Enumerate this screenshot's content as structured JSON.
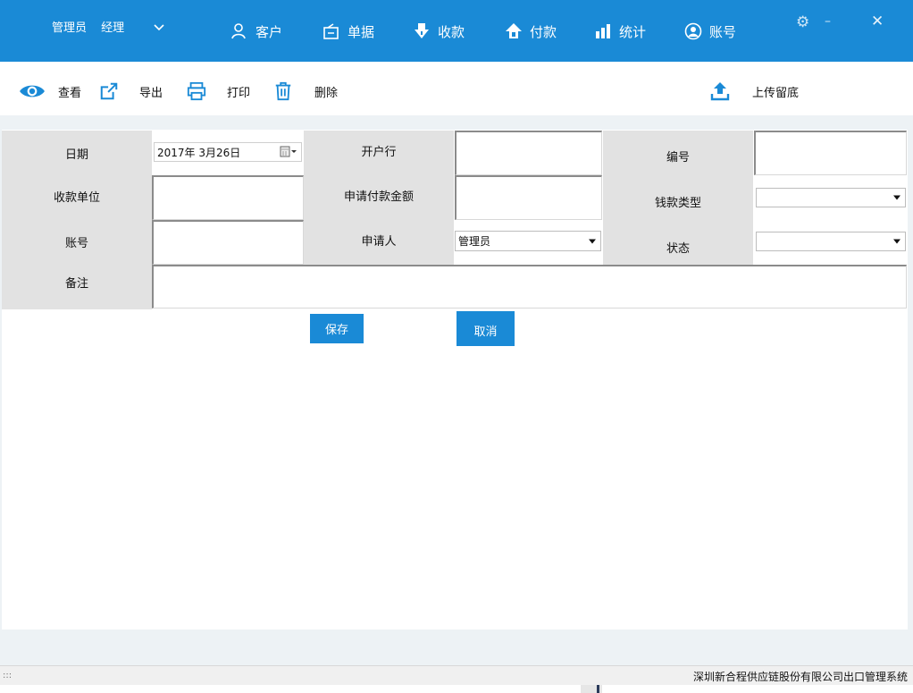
{
  "header": {
    "user": {
      "name": "管理员",
      "role": "经理"
    },
    "nav": [
      {
        "label": "客户",
        "icon": "user-icon"
      },
      {
        "label": "单据",
        "icon": "document-icon"
      },
      {
        "label": "收款",
        "icon": "receive-icon"
      },
      {
        "label": "付款",
        "icon": "pay-icon"
      },
      {
        "label": "统计",
        "icon": "bar-chart-icon"
      },
      {
        "label": "账号",
        "icon": "account-icon"
      }
    ],
    "window_controls": {
      "settings": "⚙",
      "minimize": "–",
      "close": "✕"
    }
  },
  "toolbar": {
    "view_label": "查看",
    "export_label": "导出",
    "print_label": "打印",
    "delete_label": "删除",
    "upload_label": "上传留底"
  },
  "form": {
    "date_label": "日期",
    "date_value": "2017年  3月26日",
    "bank_label": "开户行",
    "bank_value": "",
    "number_label": "编号",
    "number_value": "",
    "payee_label": "收款单位",
    "payee_value": "",
    "amount_label": "申请付款金额",
    "amount_value": "",
    "money_type_label": "钱款类型",
    "money_type_value": "",
    "account_label": "账号",
    "account_value": "",
    "applicant_label": "申请人",
    "applicant_value": "管理员",
    "status_label": "状态",
    "status_value": "",
    "remark_label": "备注",
    "remark_value": "",
    "save_label": "保存",
    "cancel_label": "取消"
  },
  "statusbar": {
    "text": "深圳新合程供应链股份有限公司出口管理系统",
    "grip": ":::"
  },
  "colors": {
    "primary": "#1a8ad6",
    "label_bg": "#e2e2e2",
    "page_bg": "#edf2f5"
  }
}
